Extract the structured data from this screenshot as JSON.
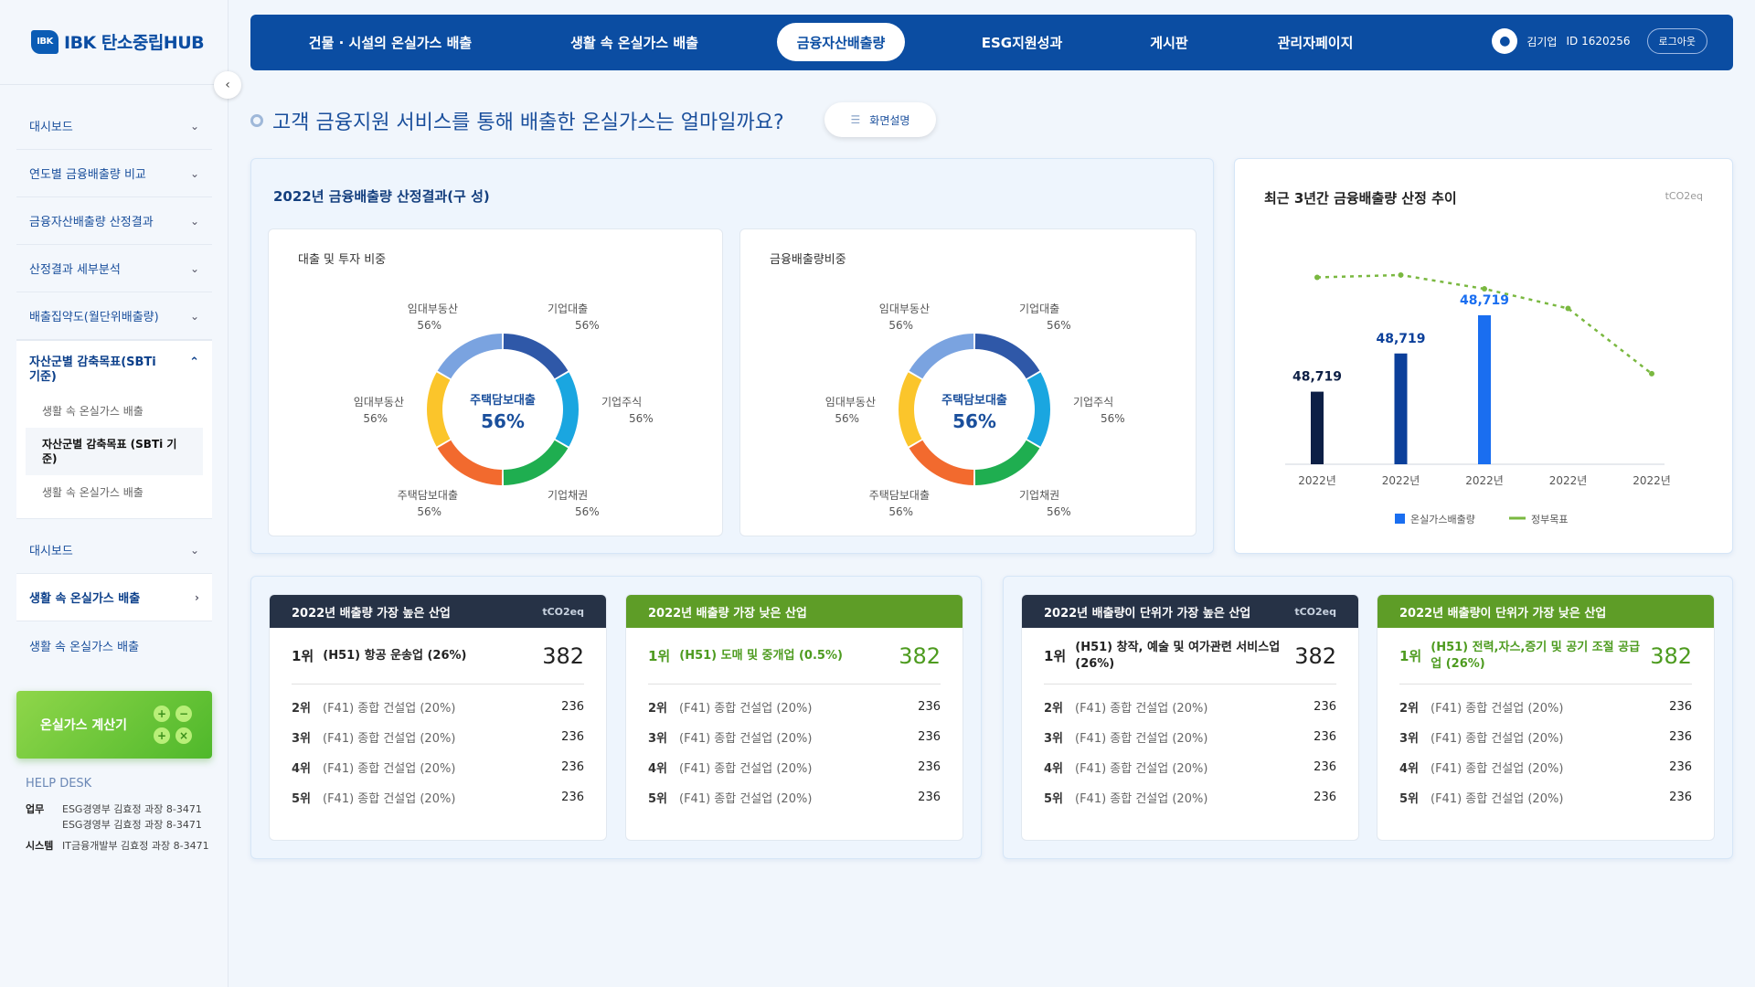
{
  "app": {
    "logo_mark": "IBK",
    "logo_text": "IBK 탄소중립HUB"
  },
  "topnav": {
    "tabs": [
      {
        "label": "건물 · 시설의 온실가스 배출"
      },
      {
        "label": "생활 속 온실가스 배출"
      },
      {
        "label": "금융자산배출량"
      },
      {
        "label": "ESG지원성과"
      },
      {
        "label": "게시판"
      },
      {
        "label": "관리자페이지"
      }
    ],
    "user_name": "김기업",
    "user_id": "ID 1620256",
    "logout": "로그아웃"
  },
  "sidebar": {
    "items_top": [
      {
        "label": "대시보드"
      },
      {
        "label": "연도별 금융배출량 비교"
      },
      {
        "label": "금융자산배출량 산정결과"
      },
      {
        "label": "산정결과 세부분석"
      },
      {
        "label": "배출집약도(월단위배출량)"
      }
    ],
    "group": {
      "label": "자산군별 감축목표(SBTi 기준)",
      "subs": [
        "생활 속 온실가스 배출",
        "자산군별 감축목표 (SBTi 기준)",
        "생활 속 온실가스 배출"
      ]
    },
    "items_bottom": [
      {
        "label": "대시보드"
      },
      {
        "label": "생활 속 온실가스 배출"
      },
      {
        "label": "생활 속 온실가스 배출"
      }
    ],
    "calculator": "온실가스 계산기",
    "calc_keys": [
      "+",
      "−",
      "+",
      "×"
    ],
    "help": {
      "title": "HELP DESK",
      "rows": [
        {
          "k": "업무",
          "v": "ESG경영부 김효정 과장 8-3471"
        },
        {
          "k": "",
          "v": "ESG경영부 김효정 과장 8-3471"
        },
        {
          "k": "시스템",
          "v": "IT금융개발부 김효정 과장 8-3471"
        }
      ]
    }
  },
  "page": {
    "title": "고객 금융지원 서비스를 통해 배출한 온실가스는 얼마일까요?",
    "explain": "화면설명"
  },
  "composition": {
    "title": "2022년 금융배출량 산정결과(구 성)",
    "donuts": [
      {
        "title": "대출 및 투자 비중",
        "center_label": "주택담보대출",
        "center_value": "56%"
      },
      {
        "title": "금융배출량비중",
        "center_label": "주택담보대출",
        "center_value": "56%"
      }
    ]
  },
  "trend": {
    "title": "최근 3년간 금융배출량 산정 추이",
    "unit": "tCO2eq"
  },
  "chart_data": [
    {
      "type": "pie",
      "title": "대출 및 투자 비중",
      "center": {
        "label": "주택담보대출",
        "value": "56%"
      },
      "slices": [
        {
          "label": "기업대출",
          "value": 56,
          "display": "56%",
          "color": "#2f58a8"
        },
        {
          "label": "기업주식",
          "value": 56,
          "display": "56%",
          "color": "#1aa6e0"
        },
        {
          "label": "기업채권",
          "value": 56,
          "display": "56%",
          "color": "#1fae50"
        },
        {
          "label": "주택담보대출",
          "value": 56,
          "display": "56%",
          "color": "#f26a2e"
        },
        {
          "label": "임대부동산",
          "value": 56,
          "display": "56%",
          "color": "#fbc52b"
        },
        {
          "label": "임대부동산",
          "value": 56,
          "display": "56%",
          "color": "#7aa3e0"
        }
      ]
    },
    {
      "type": "pie",
      "title": "금융배출량비중",
      "center": {
        "label": "주택담보대출",
        "value": "56%"
      },
      "slices": [
        {
          "label": "기업대출",
          "value": 56,
          "display": "56%",
          "color": "#2f58a8"
        },
        {
          "label": "기업주식",
          "value": 56,
          "display": "56%",
          "color": "#1aa6e0"
        },
        {
          "label": "기업채권",
          "value": 56,
          "display": "56%",
          "color": "#1fae50"
        },
        {
          "label": "주택담보대출",
          "value": 56,
          "display": "56%",
          "color": "#f26a2e"
        },
        {
          "label": "임대부동산",
          "value": 56,
          "display": "56%",
          "color": "#fbc52b"
        },
        {
          "label": "임대부동산",
          "value": 56,
          "display": "56%",
          "color": "#7aa3e0"
        }
      ]
    },
    {
      "type": "bar",
      "title": "최근 3년간 금융배출량 산정 추이",
      "unit": "tCO2eq",
      "categories": [
        "2022년",
        "2022년",
        "2022년",
        "2022년",
        "2022년"
      ],
      "series": [
        {
          "name": "온실가스배출량",
          "type": "bar",
          "values": [
            48719,
            48719,
            48719,
            null,
            null
          ],
          "labels": [
            "48,719",
            "48,719",
            "48,719"
          ],
          "colors": [
            "#0d1f45",
            "#0b3f9a",
            "#1a6ef0"
          ]
        },
        {
          "name": "정부목표",
          "type": "line",
          "values": [
            48700,
            49300,
            45700,
            40600,
            23600
          ],
          "color": "#7ab840"
        }
      ],
      "legend": "bottom",
      "ylim": [
        0,
        70000
      ]
    }
  ],
  "rankings": [
    {
      "title": "2022년 배출량 가장 높은 산업",
      "unit": "tCO2eq",
      "theme": "dark",
      "top": {
        "rank": "1위",
        "name": "(H51) 항공 운송업 (26%)",
        "value": "382"
      },
      "rows": [
        {
          "rank": "2위",
          "name": "(F41) 종합 건설업 (20%)",
          "value": "236"
        },
        {
          "rank": "3위",
          "name": "(F41) 종합 건설업 (20%)",
          "value": "236"
        },
        {
          "rank": "4위",
          "name": "(F41) 종합 건설업 (20%)",
          "value": "236"
        },
        {
          "rank": "5위",
          "name": "(F41) 종합 건설업 (20%)",
          "value": "236"
        }
      ]
    },
    {
      "title": "2022년 배출량 가장 낮은 산업",
      "unit": "",
      "theme": "green",
      "top": {
        "rank": "1위",
        "name": "(H51) 도매 및 중개업 (0.5%)",
        "value": "382"
      },
      "rows": [
        {
          "rank": "2위",
          "name": "(F41) 종합 건설업 (20%)",
          "value": "236"
        },
        {
          "rank": "3위",
          "name": "(F41) 종합 건설업 (20%)",
          "value": "236"
        },
        {
          "rank": "4위",
          "name": "(F41) 종합 건설업 (20%)",
          "value": "236"
        },
        {
          "rank": "5위",
          "name": "(F41) 종합 건설업 (20%)",
          "value": "236"
        }
      ]
    },
    {
      "title": "2022년 배출량이 단위가 가장 높은 산업",
      "unit": "tCO2eq",
      "theme": "dark",
      "top": {
        "rank": "1위",
        "name": "(H51) 창작, 예술 및 여가관련 서비스업 (26%)",
        "value": "382"
      },
      "rows": [
        {
          "rank": "2위",
          "name": "(F41) 종합 건설업 (20%)",
          "value": "236"
        },
        {
          "rank": "3위",
          "name": "(F41) 종합 건설업 (20%)",
          "value": "236"
        },
        {
          "rank": "4위",
          "name": "(F41) 종합 건설업 (20%)",
          "value": "236"
        },
        {
          "rank": "5위",
          "name": "(F41) 종합 건설업 (20%)",
          "value": "236"
        }
      ]
    },
    {
      "title": "2022년 배출량이 단위가 가장 낮은 산업",
      "unit": "",
      "theme": "green",
      "top": {
        "rank": "1위",
        "name": "(H51) 전력,자스,증기 및 공기 조절 공급업 (26%)",
        "value": "382"
      },
      "rows": [
        {
          "rank": "2위",
          "name": "(F41) 종합 건설업 (20%)",
          "value": "236"
        },
        {
          "rank": "3위",
          "name": "(F41) 종합 건설업 (20%)",
          "value": "236"
        },
        {
          "rank": "4위",
          "name": "(F41) 종합 건설업 (20%)",
          "value": "236"
        },
        {
          "rank": "5위",
          "name": "(F41) 종합 건설업 (20%)",
          "value": "236"
        }
      ]
    }
  ]
}
